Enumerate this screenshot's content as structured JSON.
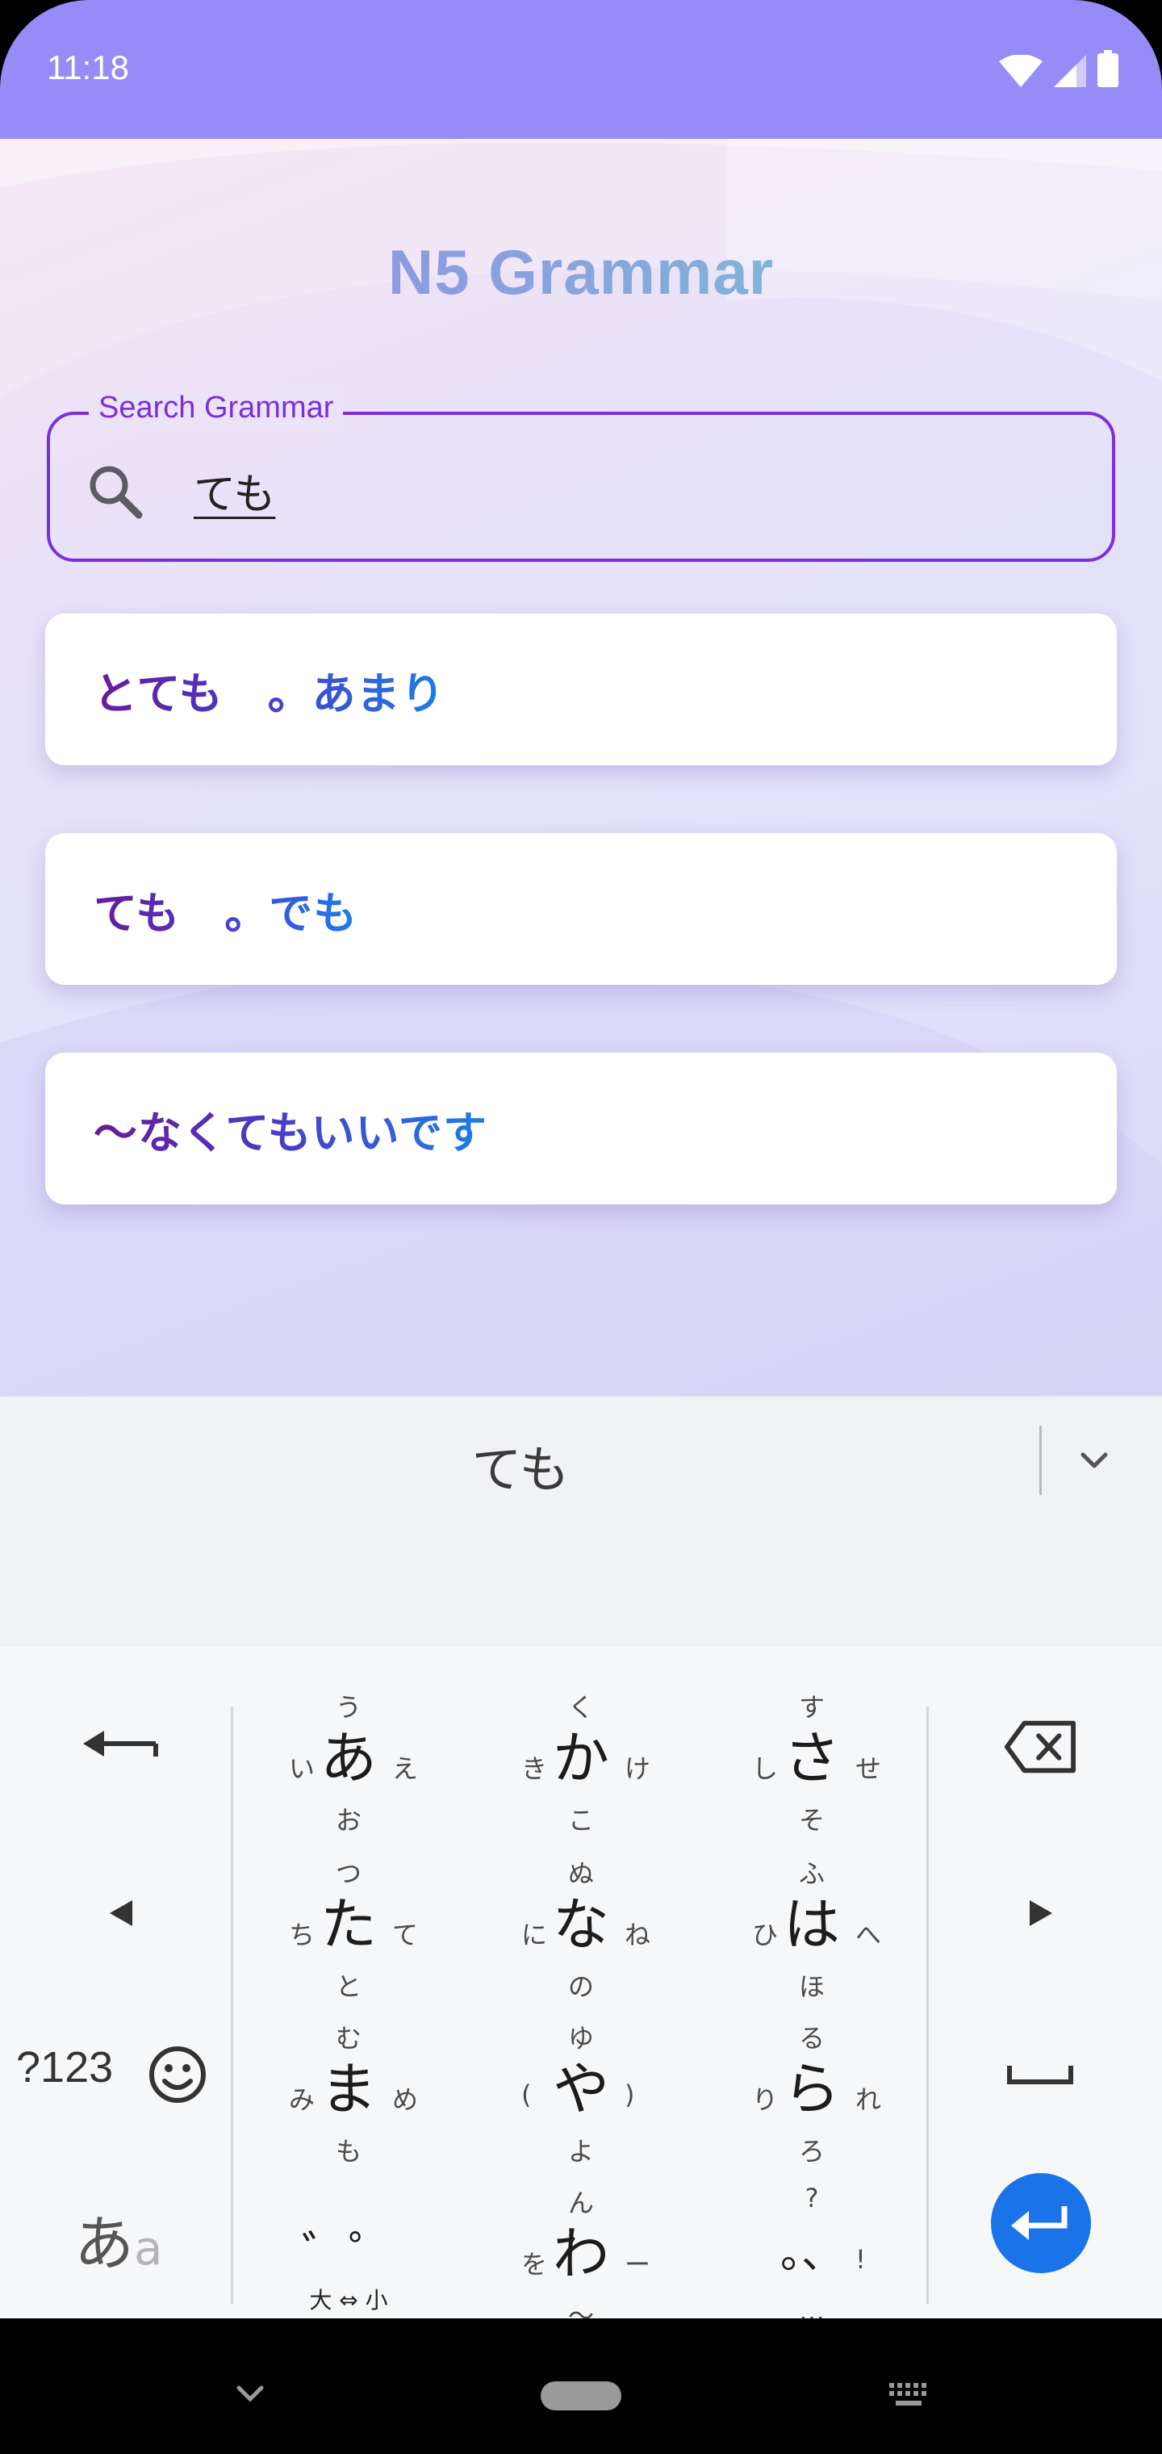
{
  "status_bar": {
    "time": "11:18"
  },
  "app": {
    "title": "N5 Grammar",
    "search": {
      "label": "Search Grammar",
      "value": "ても"
    },
    "results": [
      {
        "text": "とても　。あまり"
      },
      {
        "text": "ても　。でも"
      },
      {
        "text": "〜なくてもいいです"
      }
    ],
    "colors": {
      "accent": "#7b2ee0",
      "status_bar": "#958cf7",
      "enter": "#1a73e8"
    }
  },
  "keyboard": {
    "suggestion": "ても",
    "rows": [
      [
        {
          "main": "あ",
          "up": "う",
          "down": "お",
          "left": "い",
          "right": "え"
        },
        {
          "main": "か",
          "up": "く",
          "down": "こ",
          "left": "き",
          "right": "け"
        },
        {
          "main": "さ",
          "up": "す",
          "down": "そ",
          "left": "し",
          "right": "せ"
        }
      ],
      [
        {
          "main": "た",
          "up": "つ",
          "down": "と",
          "left": "ち",
          "right": "て"
        },
        {
          "main": "な",
          "up": "ぬ",
          "down": "の",
          "left": "に",
          "right": "ね"
        },
        {
          "main": "は",
          "up": "ふ",
          "down": "ほ",
          "left": "ひ",
          "right": "へ"
        }
      ],
      [
        {
          "main": "ま",
          "up": "む",
          "down": "も",
          "left": "み",
          "right": "め"
        },
        {
          "main": "や",
          "up": "ゆ",
          "down": "よ",
          "left": "(",
          "right": ")"
        },
        {
          "main": "ら",
          "up": "る",
          "down": "ろ",
          "left": "り",
          "right": "れ"
        }
      ],
      [
        {
          "main": "゛゜",
          "up": "",
          "down": "大 ⇔ 小",
          "left": "",
          "right": ""
        },
        {
          "main": "わ",
          "up": "ん",
          "down": "〜",
          "left": "を",
          "right": "ー"
        },
        {
          "main": "。、",
          "up": "?",
          "down": "…",
          "left": "",
          "right": "!"
        }
      ]
    ],
    "symbols_label": "?123",
    "mode_main": "あ",
    "mode_sub": "a"
  }
}
